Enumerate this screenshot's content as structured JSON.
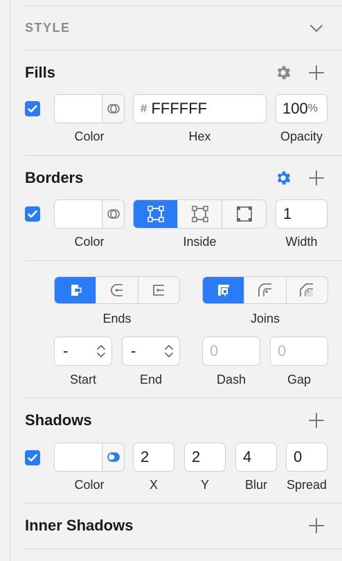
{
  "style": {
    "title": "STYLE"
  },
  "fills": {
    "title": "Fills",
    "enabled": true,
    "hex_prefix": "#",
    "hex": "FFFFFF",
    "opacity_value": "100",
    "opacity_unit": "%",
    "labels": {
      "color": "Color",
      "hex": "Hex",
      "opacity": "Opacity"
    }
  },
  "borders": {
    "title": "Borders",
    "enabled": true,
    "position_selected": "inside",
    "width": "1",
    "labels": {
      "color": "Color",
      "position": "Inside",
      "width": "Width"
    },
    "accent": "#2a7cf6"
  },
  "line_options": {
    "ends_label": "Ends",
    "joins_label": "Joins",
    "start_value": "-",
    "end_value": "-",
    "dash_placeholder": "0",
    "gap_placeholder": "0",
    "labels": {
      "start": "Start",
      "end": "End",
      "dash": "Dash",
      "gap": "Gap"
    }
  },
  "shadows": {
    "title": "Shadows",
    "enabled": true,
    "x": "2",
    "y": "2",
    "blur": "4",
    "spread": "0",
    "labels": {
      "color": "Color",
      "x": "X",
      "y": "Y",
      "blur": "Blur",
      "spread": "Spread"
    }
  },
  "inner_shadows": {
    "title": "Inner Shadows"
  },
  "colors": {
    "accent": "#2a7cf6",
    "separator": "#d6d6d6",
    "background": "#f2f2f2"
  }
}
